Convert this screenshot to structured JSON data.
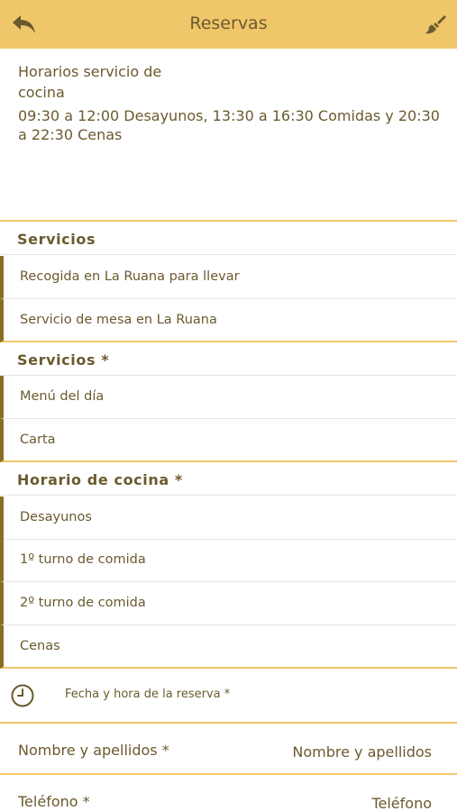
{
  "header": {
    "title": "Reservas",
    "back_icon": "back-arrow-icon",
    "clear_icon": "brush-icon",
    "bar_color": "#f0c66a"
  },
  "info": {
    "heading": "Horarios servicio de cocina",
    "schedule": "09:30 a 12:00 Desayunos, 13:30 a 16:30 Comidas y 20:30 a 22:30 Cenas"
  },
  "sections": [
    {
      "title": "Servicios",
      "options": [
        "Recogida en La Ruana para llevar",
        "Servicio de mesa en La Ruana"
      ]
    },
    {
      "title": "Servicios *",
      "options": [
        "Menú del día",
        "Carta"
      ]
    },
    {
      "title": "Horario de cocina *",
      "options": [
        "Desayunos",
        "1º turno de comida",
        "2º turno de comida",
        "Cenas"
      ]
    }
  ],
  "reservation_date": {
    "label": "Fecha y hora de la reserva *",
    "icon": "clock-icon"
  },
  "name_field": {
    "label": "Nombre y apellidos *",
    "placeholder": "Nombre y apellidos"
  },
  "phone_field": {
    "label": "Teléfono *",
    "placeholder": "Teléfono"
  }
}
